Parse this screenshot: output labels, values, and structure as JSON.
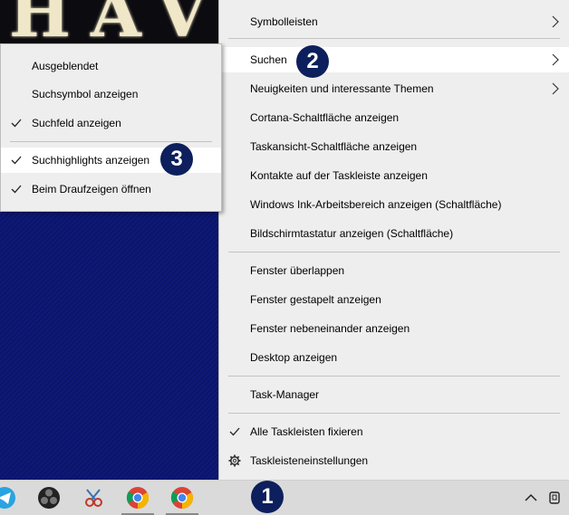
{
  "banner": {
    "text": "HAVO"
  },
  "main_menu": {
    "items": [
      {
        "label": "Symbolleisten",
        "submenu": true
      },
      {
        "label": "Suchen",
        "submenu": true,
        "highlighted": true
      },
      {
        "label": "Neuigkeiten und interessante Themen",
        "submenu": true
      },
      {
        "label": "Cortana-Schaltfläche anzeigen"
      },
      {
        "label": "Taskansicht-Schaltfläche anzeigen"
      },
      {
        "label": "Kontakte auf der Taskleiste anzeigen"
      },
      {
        "label": "Windows Ink-Arbeitsbereich anzeigen (Schaltfläche)"
      },
      {
        "label": "Bildschirmtastatur anzeigen (Schaltfläche)"
      },
      {
        "label": "Fenster überlappen"
      },
      {
        "label": "Fenster gestapelt anzeigen"
      },
      {
        "label": "Fenster nebeneinander anzeigen"
      },
      {
        "label": "Desktop anzeigen"
      },
      {
        "label": "Task-Manager"
      },
      {
        "label": "Alle Taskleisten fixieren",
        "checked": true
      },
      {
        "label": "Taskleisteneinstellungen",
        "icon": "gear-icon"
      }
    ]
  },
  "sub_menu": {
    "items": [
      {
        "label": "Ausgeblendet"
      },
      {
        "label": "Suchsymbol anzeigen"
      },
      {
        "label": "Suchfeld anzeigen",
        "checked": true
      },
      {
        "label": "Suchhighlights anzeigen",
        "checked": true,
        "highlighted": true
      },
      {
        "label": "Beim Draufzeigen öffnen",
        "checked": true
      }
    ]
  },
  "badges": [
    "1",
    "2",
    "3"
  ],
  "taskbar": {
    "icons": [
      "telegram-icon",
      "obs-icon",
      "snipping-icon",
      "chrome-icon",
      "chrome-icon"
    ],
    "tray": [
      "chevron-up-icon",
      "device-icon"
    ]
  },
  "colors": {
    "menu_bg": "#eeeeee",
    "highlight": "#ffffff",
    "badge": "#0d1f5c",
    "desktop": "#0b1468"
  }
}
